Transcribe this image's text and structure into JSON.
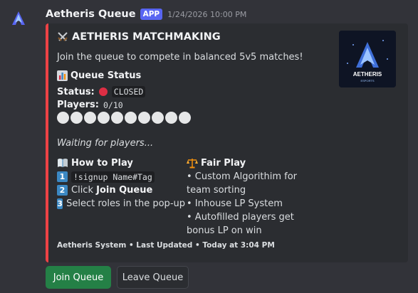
{
  "message": {
    "username": "Aetheris Queue",
    "badge": "APP",
    "timestamp": "1/24/2026 10:00 PM"
  },
  "embed": {
    "accent_color": "#ed4245",
    "title": "AETHERIS MATCHMAKING",
    "title_icon": "crossed-swords-icon",
    "description": "Join the queue to compete in balanced 5v5 matches!",
    "queue_status_heading": "Queue Status",
    "queue_status_icon": "bar-chart-icon",
    "status_label": "Status:",
    "status_value": "CLOSED",
    "status_color": "#dd2e44",
    "players_label": "Players:",
    "players_value": "0/10",
    "slots_filled": 0,
    "slots_total": 10,
    "waiting_text": "Waiting for players...",
    "thumbnail_text": "AETHERIS",
    "thumbnail_subtext": "ESPORTS",
    "how_to_play": {
      "title": "How to Play",
      "icon": "open-book-icon",
      "steps": [
        {
          "num": "1",
          "code": "!signup Name#Tag"
        },
        {
          "num": "2",
          "pre": "Click ",
          "bold": "Join Queue"
        },
        {
          "num": "3",
          "text": "Select roles in the pop-up"
        }
      ]
    },
    "fair_play": {
      "title": "Fair Play",
      "icon": "balance-scale-icon",
      "items": [
        "• Custom Algorithim for team sorting",
        "• Inhouse LP System",
        "• Autofilled players get bonus LP on win"
      ]
    },
    "footer": "Aetheris System • Last Updated • Today at 3:04 PM"
  },
  "buttons": {
    "join": "Join Queue",
    "leave": "Leave Queue"
  }
}
